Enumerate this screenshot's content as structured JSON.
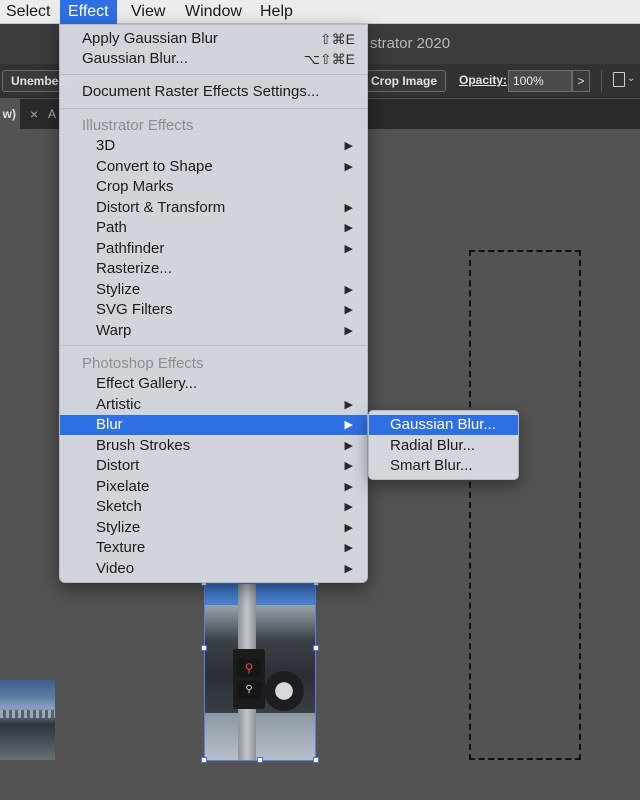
{
  "menubar": {
    "items": [
      {
        "label": "Select"
      },
      {
        "label": "Effect",
        "active": true
      },
      {
        "label": "View"
      },
      {
        "label": "Window"
      },
      {
        "label": "Help"
      }
    ]
  },
  "titlebar": {
    "app_title": "strator 2020"
  },
  "controlbar": {
    "unembed_label": "Unembed",
    "crop_label": "Crop Image",
    "opacity_label": "Opacity:",
    "opacity_value": "100%",
    "opacity_arrow": ">"
  },
  "tabs": {
    "active_label": "w)",
    "second_close": "×",
    "second_label": "A"
  },
  "artwork": {
    "sign_red_glyph": "⚲",
    "sign_white_glyph": "⚲"
  },
  "effect_menu": {
    "top_items": [
      {
        "label": "Apply Gaussian Blur",
        "shortcut": "⇧⌘E"
      },
      {
        "label": "Gaussian Blur...",
        "shortcut": "⌥⇧⌘E"
      },
      {
        "label": "Document Raster Effects Settings..."
      }
    ],
    "illustrator_header": "Illustrator Effects",
    "illustrator_items": [
      {
        "label": "3D",
        "submenu": true
      },
      {
        "label": "Convert to Shape",
        "submenu": true
      },
      {
        "label": "Crop Marks",
        "submenu": false
      },
      {
        "label": "Distort & Transform",
        "submenu": true
      },
      {
        "label": "Path",
        "submenu": true
      },
      {
        "label": "Pathfinder",
        "submenu": true
      },
      {
        "label": "Rasterize...",
        "submenu": false
      },
      {
        "label": "Stylize",
        "submenu": true
      },
      {
        "label": "SVG Filters",
        "submenu": true
      },
      {
        "label": "Warp",
        "submenu": true
      }
    ],
    "photoshop_header": "Photoshop Effects",
    "photoshop_items": [
      {
        "label": "Effect Gallery...",
        "submenu": false
      },
      {
        "label": "Artistic",
        "submenu": true
      },
      {
        "label": "Blur",
        "submenu": true,
        "highlighted": true
      },
      {
        "label": "Brush Strokes",
        "submenu": true
      },
      {
        "label": "Distort",
        "submenu": true
      },
      {
        "label": "Pixelate",
        "submenu": true
      },
      {
        "label": "Sketch",
        "submenu": true
      },
      {
        "label": "Stylize",
        "submenu": true
      },
      {
        "label": "Texture",
        "submenu": true
      },
      {
        "label": "Video",
        "submenu": true
      }
    ],
    "arrow_glyph": "▶"
  },
  "blur_submenu": {
    "items": [
      {
        "label": "Gaussian Blur...",
        "highlighted": true
      },
      {
        "label": "Radial Blur..."
      },
      {
        "label": "Smart Blur..."
      }
    ]
  },
  "colors": {
    "accent": "#2f6fe4",
    "canvas": "#535353",
    "menu_bg": "#d6dae0"
  }
}
